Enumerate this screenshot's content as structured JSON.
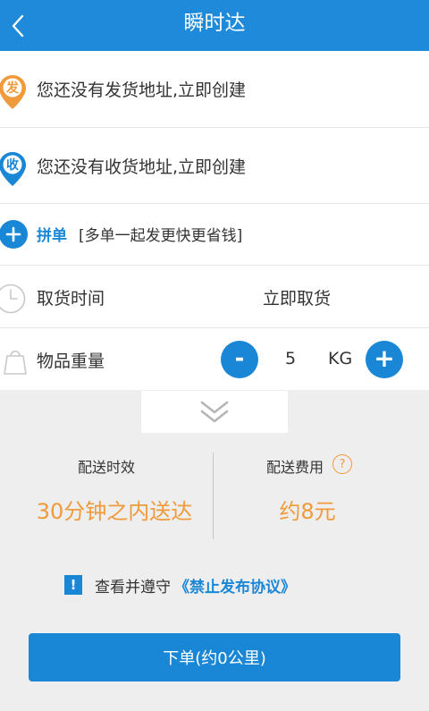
{
  "header": {
    "title": "瞬时达",
    "back_icon": "chevron-left-icon"
  },
  "sender": {
    "badge": "发",
    "text": "您还没有发货地址,立即创建",
    "color": "#ef9a3b"
  },
  "receiver": {
    "badge": "收",
    "text": "您还没有收货地址,立即创建",
    "color": "#1a87d6"
  },
  "combine": {
    "label": "拼单",
    "hint": "[多单一起发更快更省钱]"
  },
  "pickup": {
    "label": "取货时间",
    "value": "立即取货"
  },
  "weight": {
    "label": "物品重量",
    "minus": "-",
    "value": "5",
    "unit": "KG",
    "plus": "+"
  },
  "delivery": {
    "time_label": "配送时效",
    "time_value": "30分钟之内送达",
    "fee_label": "配送费用",
    "fee_help": "?",
    "fee_value": "约8元"
  },
  "notice": {
    "icon": "!",
    "text": "查看并遵守",
    "link": "《禁止发布协议》"
  },
  "submit_label": "下单(约0公里)",
  "colors": {
    "primary": "#1a87d6",
    "header": "#1f8ad9",
    "accent": "#ef9a3b",
    "background": "#eeeeee"
  }
}
